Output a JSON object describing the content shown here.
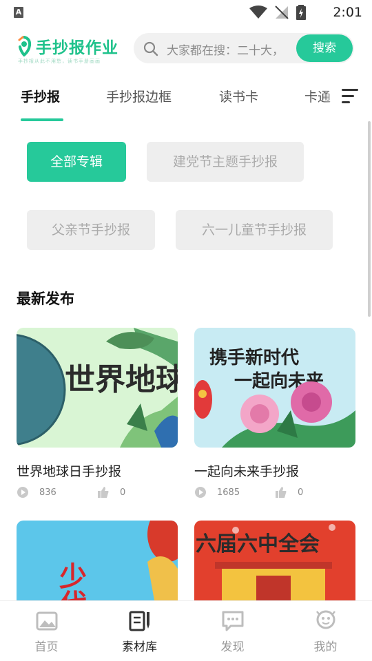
{
  "status_bar": {
    "notification_letter": "A",
    "time": "2:01"
  },
  "header": {
    "logo_text": "手抄报作业",
    "logo_subtitle": "手抄报从此不用愁，读书手册画画",
    "search": {
      "placeholder": "大家都在搜：二十大，",
      "button_label": "搜索"
    }
  },
  "tabs": [
    "手抄报",
    "手抄报边框",
    "读书卡",
    "卡通"
  ],
  "active_tab": 0,
  "chips": [
    "全部专辑",
    "建党节主题手抄报",
    "父亲节手抄报",
    "六一儿童节手抄报"
  ],
  "active_chip": 0,
  "section_title": "最新发布",
  "cards": [
    {
      "title": "世界地球日手抄报",
      "views": "836",
      "likes": "0",
      "image_text": "世界地球"
    },
    {
      "title": "一起向未来手抄报",
      "views": "1685",
      "likes": "0",
      "image_text_line1": "携手新时代",
      "image_text_line2": "一起向未来"
    },
    {
      "title": "",
      "image_text": "少代"
    },
    {
      "title": "",
      "image_text": "六届六中全会"
    }
  ],
  "bottom_nav": [
    {
      "label": "首页",
      "icon": "picture-icon"
    },
    {
      "label": "素材库",
      "icon": "library-icon"
    },
    {
      "label": "发现",
      "icon": "message-icon"
    },
    {
      "label": "我的",
      "icon": "user-icon"
    }
  ],
  "active_nav": 1,
  "colors": {
    "accent": "#26c99a",
    "logo_green": "#1ec28b",
    "chip_bg": "#eeeeee"
  }
}
